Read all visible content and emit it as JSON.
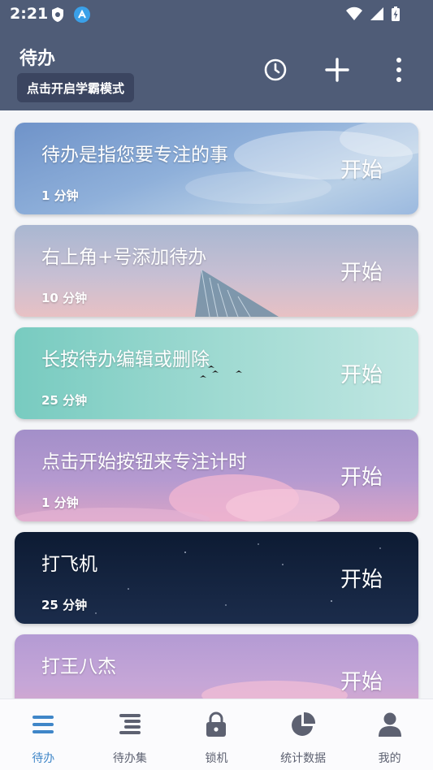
{
  "status_bar": {
    "time": "2:21"
  },
  "app_bar": {
    "title": "待办",
    "mode_button": "点击开启学霸模式"
  },
  "todos": [
    {
      "title": "待办是指您要专注的事",
      "duration": "1 分钟",
      "start": "开始"
    },
    {
      "title": "右上角+号添加待办",
      "duration": "10 分钟",
      "start": "开始"
    },
    {
      "title": "长按待办编辑或删除",
      "duration": "25 分钟",
      "start": "开始"
    },
    {
      "title": "点击开始按钮来专注计时",
      "duration": "1 分钟",
      "start": "开始"
    },
    {
      "title": "打飞机",
      "duration": "25 分钟",
      "start": "开始"
    },
    {
      "title": "打王八杰",
      "duration": "",
      "start": "开始"
    }
  ],
  "bottom_nav": [
    {
      "label": "待办",
      "icon": "todo-list-icon",
      "active": true
    },
    {
      "label": "待办集",
      "icon": "todo-collection-icon",
      "active": false
    },
    {
      "label": "锁机",
      "icon": "lock-icon",
      "active": false
    },
    {
      "label": "统计数据",
      "icon": "pie-chart-icon",
      "active": false
    },
    {
      "label": "我的",
      "icon": "user-icon",
      "active": false
    }
  ],
  "colors": {
    "app_bar": "#4f5c77",
    "active_tab": "#3f86c8",
    "inactive_tab": "#5d6171"
  }
}
